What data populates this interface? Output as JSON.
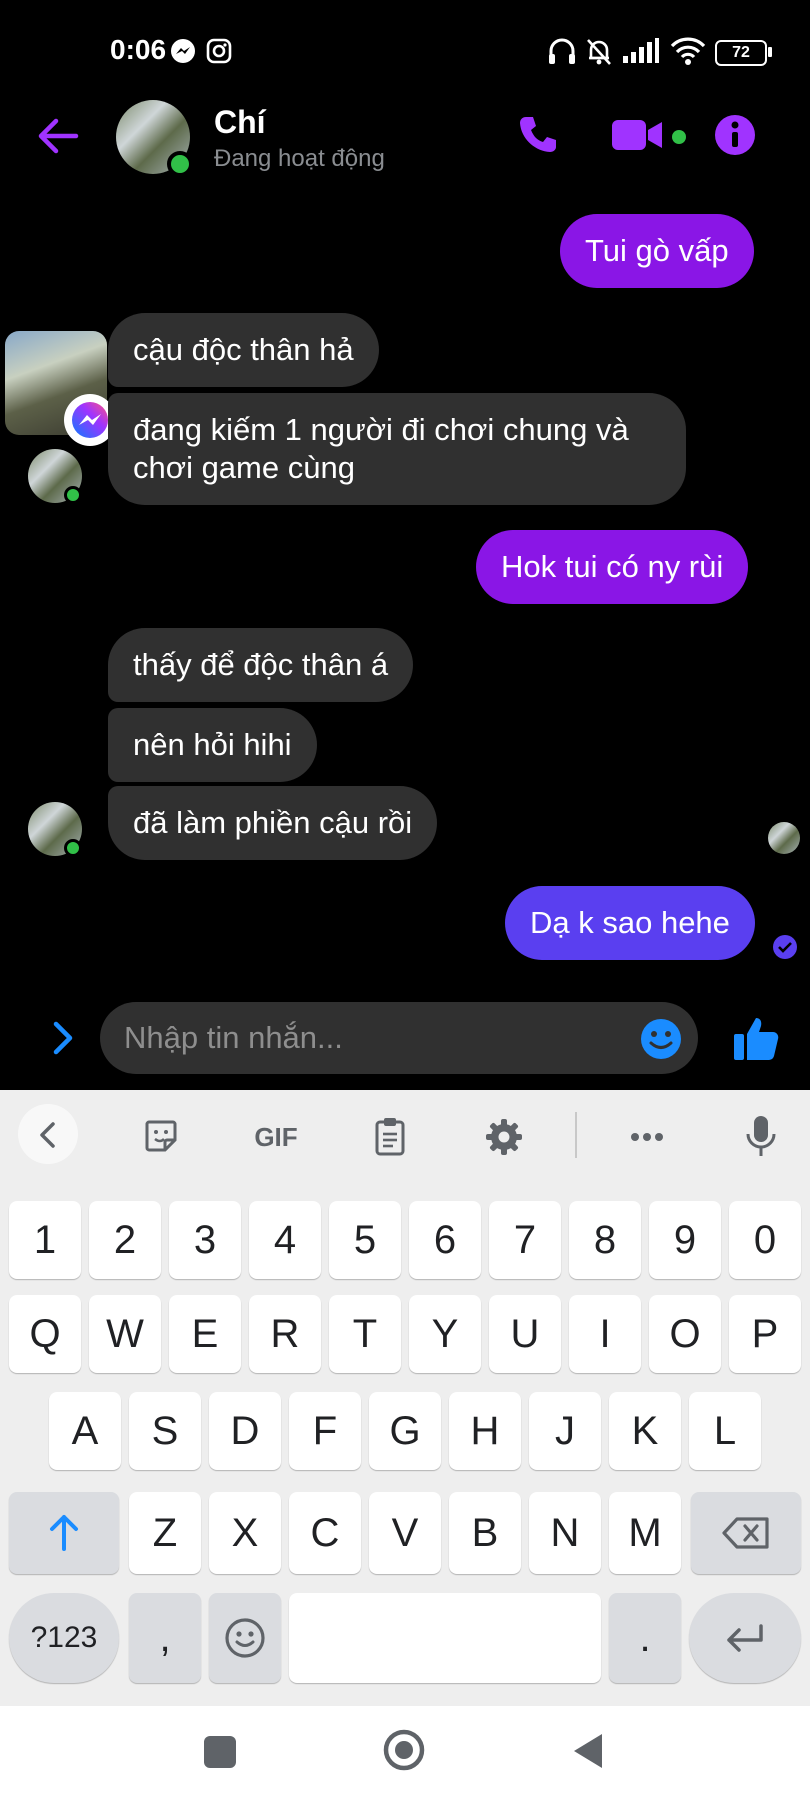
{
  "status_bar": {
    "time": "0:06",
    "battery": "72"
  },
  "header": {
    "contact_name": "Chí",
    "presence": "Đang hoạt động"
  },
  "messages": [
    {
      "side": "out",
      "text": "Tui gò vấp"
    },
    {
      "side": "in",
      "text": "cậu độc thân hả"
    },
    {
      "side": "in",
      "text": "đang kiếm 1 người đi chơi chung và\nchơi game cùng"
    },
    {
      "side": "out",
      "text": "Hok tui có ny rùi"
    },
    {
      "side": "in",
      "text": "thấy để độc thân á"
    },
    {
      "side": "in",
      "text": "nên hỏi hihi"
    },
    {
      "side": "in",
      "text": "đã làm phiền cậu rồi"
    },
    {
      "side": "out",
      "text": "Dạ k sao hehe"
    }
  ],
  "composer": {
    "placeholder": "Nhập tin nhắn..."
  },
  "keyboard": {
    "toolbar": {
      "gif": "GIF"
    },
    "row_numbers": [
      "1",
      "2",
      "3",
      "4",
      "5",
      "6",
      "7",
      "8",
      "9",
      "0"
    ],
    "row1": [
      "Q",
      "W",
      "E",
      "R",
      "T",
      "Y",
      "U",
      "I",
      "O",
      "P"
    ],
    "row2": [
      "A",
      "S",
      "D",
      "F",
      "G",
      "H",
      "J",
      "K",
      "L"
    ],
    "row3": [
      "Z",
      "X",
      "C",
      "V",
      "B",
      "N",
      "M"
    ],
    "bottom": {
      "symbols": "?123",
      "comma": ",",
      "period": "."
    }
  },
  "colors": {
    "accent": "#a033ff",
    "outgoing_bubble": "#8a16e6",
    "last_outgoing_bubble": "#5a3ff0",
    "incoming_bubble": "#303030",
    "online": "#31c048"
  }
}
